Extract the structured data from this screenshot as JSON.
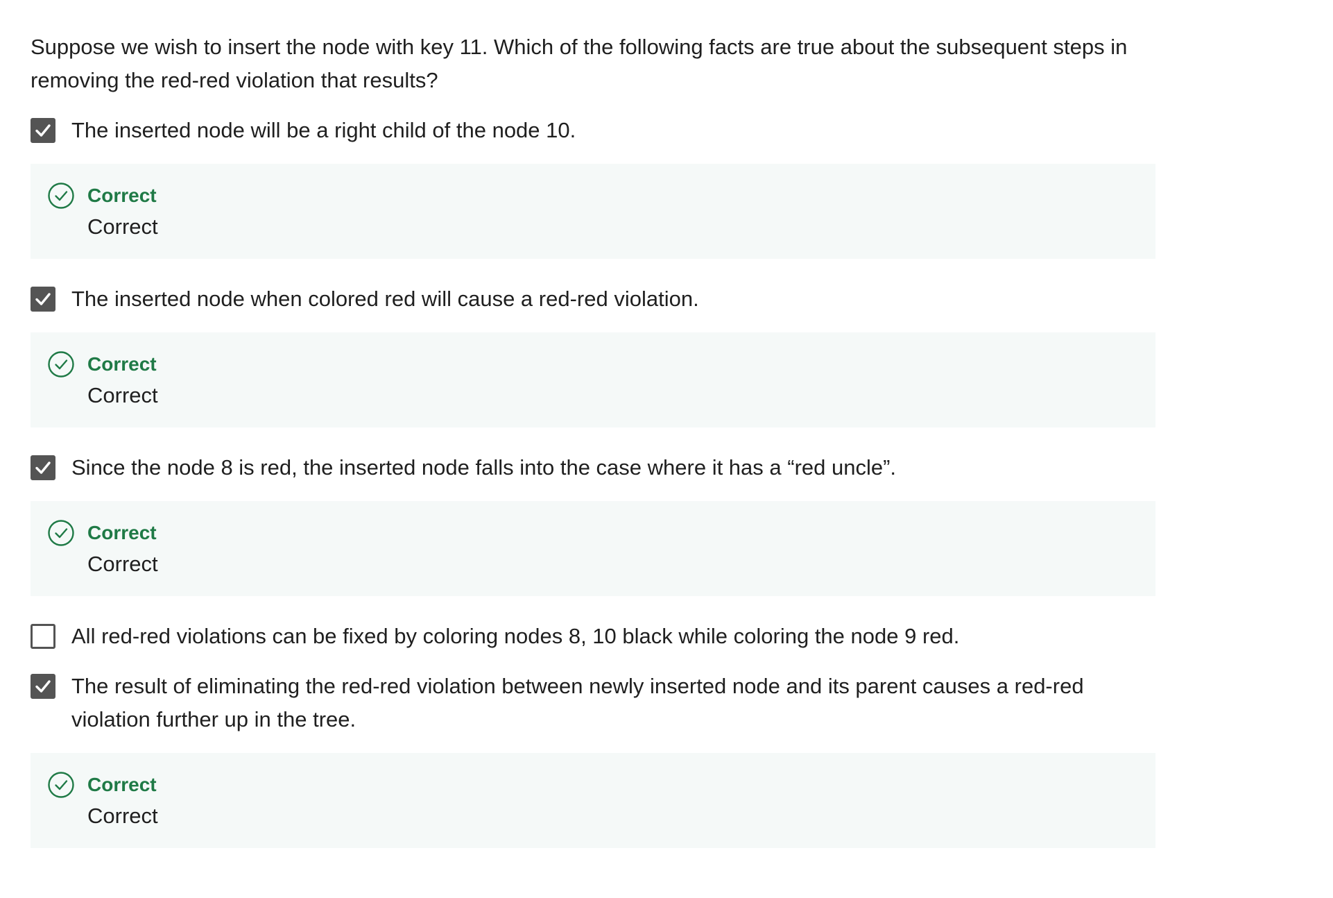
{
  "question": "Suppose we wish to insert the node with key 11. Which of the following facts are true about the subsequent steps in removing the red-red violation that results?",
  "colors": {
    "checkbox": "#545454",
    "feedback_bg": "#f5f9f8",
    "correct_green": "#1f7a46"
  },
  "options": [
    {
      "label": "The inserted node will be a right child of the node 10.",
      "checked": true,
      "feedback": {
        "icon": "check-circle-icon",
        "title": "Correct",
        "text": "Correct"
      }
    },
    {
      "label": "The inserted node when colored red will cause a red-red violation.",
      "checked": true,
      "feedback": {
        "icon": "check-circle-icon",
        "title": "Correct",
        "text": "Correct"
      }
    },
    {
      "label": "Since the node 8 is red, the inserted node falls into the case where it has a “red uncle”.",
      "checked": true,
      "feedback": {
        "icon": "check-circle-icon",
        "title": "Correct",
        "text": "Correct"
      }
    },
    {
      "label": "All red-red violations can be fixed by coloring nodes 8, 10 black while coloring the node 9 red.",
      "checked": false
    },
    {
      "label": "The result of eliminating the red-red violation between newly inserted node and its parent causes a red-red violation further up in the tree.",
      "checked": true,
      "feedback": {
        "icon": "check-circle-icon",
        "title": "Correct",
        "text": "Correct"
      }
    }
  ]
}
